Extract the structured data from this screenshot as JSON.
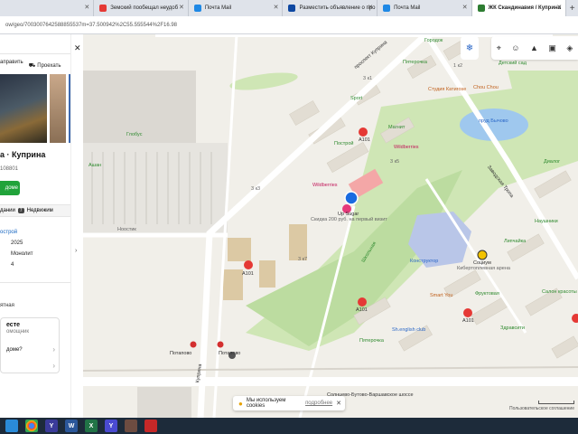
{
  "browser": {
    "tabs": [
      {
        "label": "",
        "active": false,
        "color": "#4c8bf5"
      },
      {
        "label": "Земский пообещал неудоб",
        "active": false,
        "color": "#e53935"
      },
      {
        "label": "Почта Mail",
        "active": false,
        "color": "#1e88e5"
      },
      {
        "label": "Разместить объявление о про",
        "active": false,
        "color": "#0d47a1"
      },
      {
        "label": "Почта Mail",
        "active": false,
        "color": "#1e88e5"
      },
      {
        "label": "ЖК Скандинавия / Куприна",
        "active": true,
        "color": "#2e7d32"
      }
    ],
    "url": "ow/geo/7003007642588855537m=37.500942%2C55.555544%2F16.98"
  },
  "panel": {
    "action_route": "аправить",
    "action_route2": "Проехать",
    "title": "а · Куприна",
    "id_number": "108801",
    "green_button": "доме",
    "tab_label": "дании",
    "tab_badge": "7",
    "tab_label2": "Недвижим",
    "link_text": "острой",
    "rows": [
      {
        "k": "",
        "v": "2025"
      },
      {
        "k": "",
        "v": "Монолит"
      },
      {
        "k": "",
        "v": "4"
      }
    ],
    "small_text": "ятная",
    "card": {
      "heading": "есте",
      "sub": "омощник",
      "question": "доме?"
    }
  },
  "map": {
    "labels": {
      "gorod": "Городок",
      "pyaterochka_top": "Пятерочка",
      "studio": "Студия Катиrose",
      "chou_chou": "Chou Chou",
      "childrens": "Детский сад",
      "pond": "пруд Бычово",
      "globus": "Глобус",
      "ashan": "Ашан",
      "sport": "Sport",
      "magnit": "Магнит",
      "a101_top": "А101",
      "postroy": "Построй",
      "wildberries_top": "Wildberries",
      "wildberries_mid": "Wildberries",
      "up_sugar": "Up Sugar",
      "up_sugar_sub": "Скидка 200 руб. на первый визит",
      "noostik": "Ноостик",
      "shkolnaya": "Школьная",
      "konstruktor": "Конструктор",
      "socium": "Социум",
      "socium_sub": "Кибертоплевная арена",
      "dialog": "Диалог",
      "naushnik": "Наушники",
      "lipchaika": "Липчайка",
      "fruktovaya": "Фруктовая",
      "salon": "Салон красоты",
      "zdravsiti": "Здравсити",
      "smart_you": "Smart You",
      "a101_left": "А101",
      "a101_bottom": "А101",
      "a101_mid": "А101",
      "pyaterochka_bottom": "Пятерочка",
      "english_club": "Sh.english club",
      "potapovo1": "Потапово",
      "potapovo2": "Потапово",
      "kuprina": "Куприна",
      "solntsevo": "Солнцево-Бутово-Варшавское шоссе",
      "zavodskaya": "Заводская Тропа",
      "prospekt": "проспект Куприна",
      "num_3k1": "3 к1",
      "num_3k3": "3 к3",
      "num_3k7": "3 к7",
      "num_3k5": "3 к5",
      "num_1k2": "1 к2"
    },
    "cookie_text": "Мы используем cookies",
    "cookie_more": "подробнее",
    "copyright": "Пользовательское соглашение"
  },
  "taskbar": [
    {
      "icon": "windows-start-icon",
      "label": ""
    },
    {
      "icon": "chrome-icon",
      "label": ""
    },
    {
      "icon": "yandex-icon",
      "label": "Y"
    },
    {
      "icon": "word-icon",
      "label": "W"
    },
    {
      "icon": "excel-icon",
      "label": "X"
    },
    {
      "icon": "yandex-browser-icon",
      "label": "Y"
    },
    {
      "icon": "media-icon",
      "label": ""
    },
    {
      "icon": "pdf-icon",
      "label": ""
    }
  ],
  "colors": {
    "park_green": "#cfe6b5",
    "map_bg": "#f1efe9",
    "road": "#ffffff",
    "pond": "#9fc8ee",
    "marker_blue": "#1a6be0",
    "accent_green": "#20a33a"
  }
}
